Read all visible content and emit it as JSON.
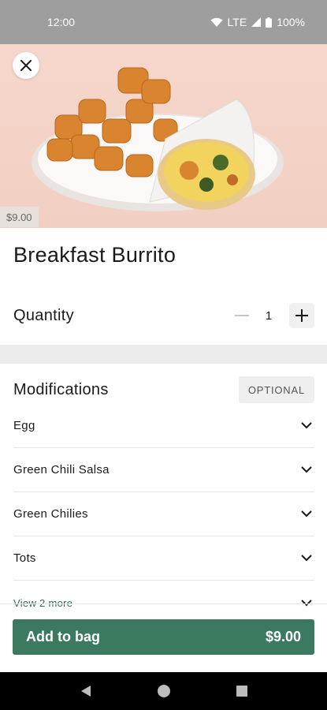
{
  "status_bar": {
    "time": "12:00",
    "network": "LTE",
    "battery": "100%"
  },
  "hero": {
    "image_alt_icon": "food-photo",
    "price": "$9.00"
  },
  "item": {
    "title": "Breakfast Burrito"
  },
  "quantity": {
    "label": "Quantity",
    "value": "1"
  },
  "modifications": {
    "title": "Modifications",
    "badge": "OPTIONAL",
    "items": [
      {
        "label": "Egg"
      },
      {
        "label": "Green Chili Salsa"
      },
      {
        "label": "Green Chilies"
      },
      {
        "label": "Tots"
      }
    ],
    "more_label": "View 2 more"
  },
  "cta": {
    "label": "Add to bag",
    "price": "$9.00"
  },
  "colors": {
    "accent": "#3c7a60",
    "link": "#2e6b52",
    "status_bar": "#9e9e9e"
  }
}
